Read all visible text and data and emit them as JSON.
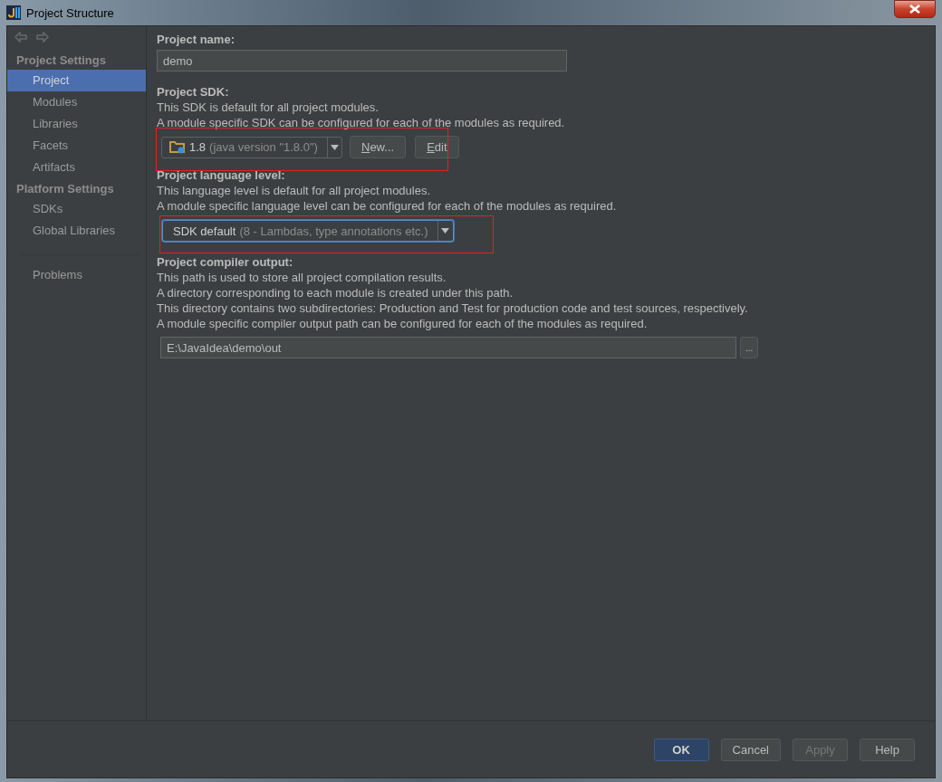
{
  "window": {
    "title": "Project Structure"
  },
  "navigation": {
    "back_disabled": true,
    "forward_disabled": true
  },
  "sidebar": {
    "sections": [
      {
        "title": "Project Settings",
        "items": [
          {
            "label": "Project",
            "selected": true
          },
          {
            "label": "Modules",
            "selected": false
          },
          {
            "label": "Libraries",
            "selected": false
          },
          {
            "label": "Facets",
            "selected": false
          },
          {
            "label": "Artifacts",
            "selected": false
          }
        ]
      },
      {
        "title": "Platform Settings",
        "items": [
          {
            "label": "SDKs",
            "selected": false
          },
          {
            "label": "Global Libraries",
            "selected": false
          }
        ]
      }
    ],
    "bottom_items": [
      {
        "label": "Problems",
        "selected": false
      }
    ]
  },
  "project_name": {
    "label": "Project name:",
    "value": "demo"
  },
  "project_sdk": {
    "label": "Project SDK:",
    "lines": [
      "This SDK is default for all project modules.",
      "A module specific SDK can be configured for each of the modules as required."
    ],
    "highlighted": true,
    "combo": {
      "name": "1.8",
      "detail": "(java version \"1.8.0\")",
      "focused": false
    },
    "buttons": [
      {
        "mnemonic": "N",
        "rest": "ew..."
      },
      {
        "mnemonic": "E",
        "rest": "dit"
      }
    ]
  },
  "language_level": {
    "label": "Project language level:",
    "lines": [
      "This language level is default for all project modules.",
      "A module specific language level can be configured for each of the modules as required."
    ],
    "highlighted": true,
    "combo": {
      "name": "SDK default",
      "detail": "(8 - Lambdas, type annotations etc.)",
      "focused": true
    }
  },
  "compiler_output": {
    "label": "Project compiler output:",
    "lines": [
      "This path is used to store all project compilation results.",
      "A directory corresponding to each module is created under this path.",
      "This directory contains two subdirectories: Production and Test for production code and test sources, respectively.",
      "A module specific compiler output path can be configured for each of the modules as required."
    ],
    "value": "E:\\JavaIdea\\demo\\out",
    "browse": "..."
  },
  "buttons": [
    {
      "label": "OK",
      "kind": "default",
      "disabled": false
    },
    {
      "label": "Cancel",
      "kind": "normal",
      "disabled": false
    },
    {
      "label": "Apply",
      "kind": "normal",
      "disabled": true
    },
    {
      "label": "Help",
      "kind": "normal",
      "disabled": false
    }
  ]
}
